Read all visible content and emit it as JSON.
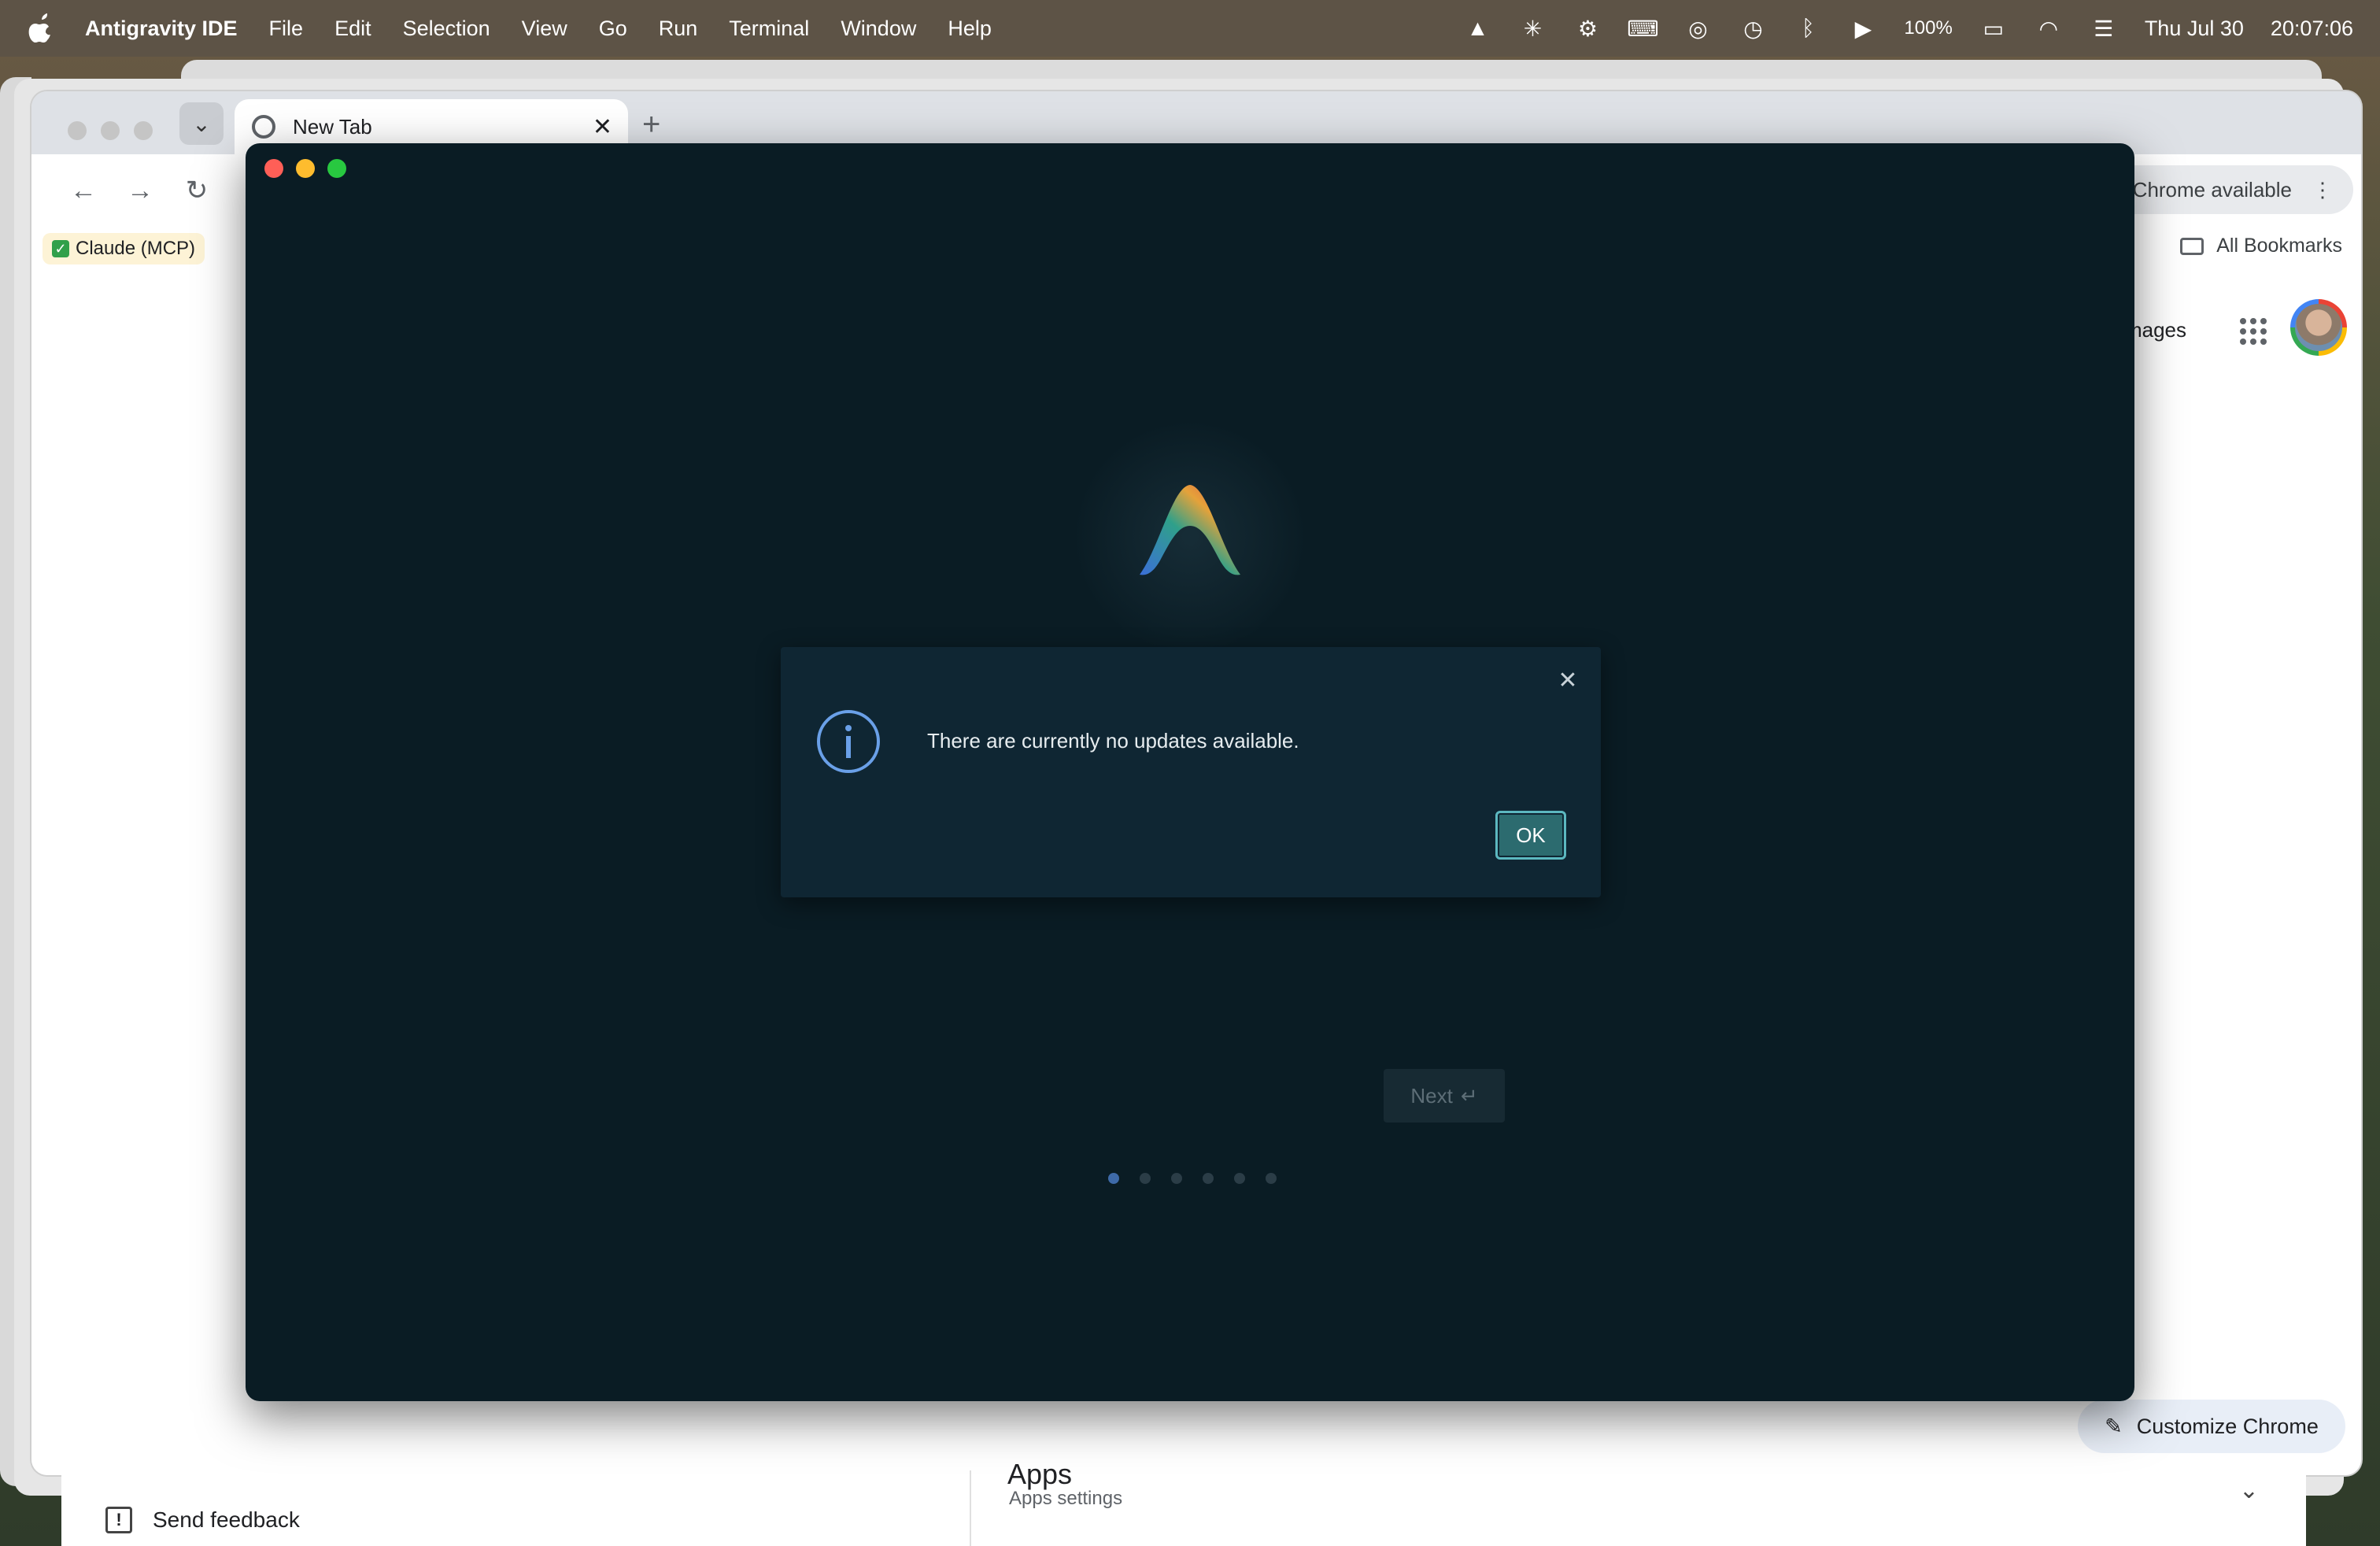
{
  "menubar": {
    "app_name": "Antigravity IDE",
    "items": [
      "File",
      "Edit",
      "Selection",
      "View",
      "Go",
      "Run",
      "Terminal",
      "Window",
      "Help"
    ],
    "battery": "100%",
    "date": "Thu Jul 30",
    "time": "20:07:06"
  },
  "chrome": {
    "tab_title": "New Tab",
    "update_label": "ew Chrome available",
    "bookmark_claude": "Claude (MCP)",
    "all_bookmarks": "All Bookmarks",
    "images_link": "Images",
    "customize_label": "Customize Chrome"
  },
  "settings_strip": {
    "feedback": "Send feedback",
    "apps_title": "Apps",
    "apps_sub": "Apps settings"
  },
  "antigravity": {
    "next_label": "Next",
    "dots_total": 6,
    "dots_active": 1,
    "dialog": {
      "message": "There are currently no updates available.",
      "ok_label": "OK"
    }
  },
  "colors": {
    "ag_background": "#0a1c24",
    "dialog_background": "#0f2633",
    "ok_button": "#2c6b6f",
    "ok_border": "#5cb8c0",
    "info_icon": "#6aa0e8",
    "close_red": "#ff5f57",
    "minimize_yellow": "#febc2e",
    "zoom_green": "#28c840"
  }
}
